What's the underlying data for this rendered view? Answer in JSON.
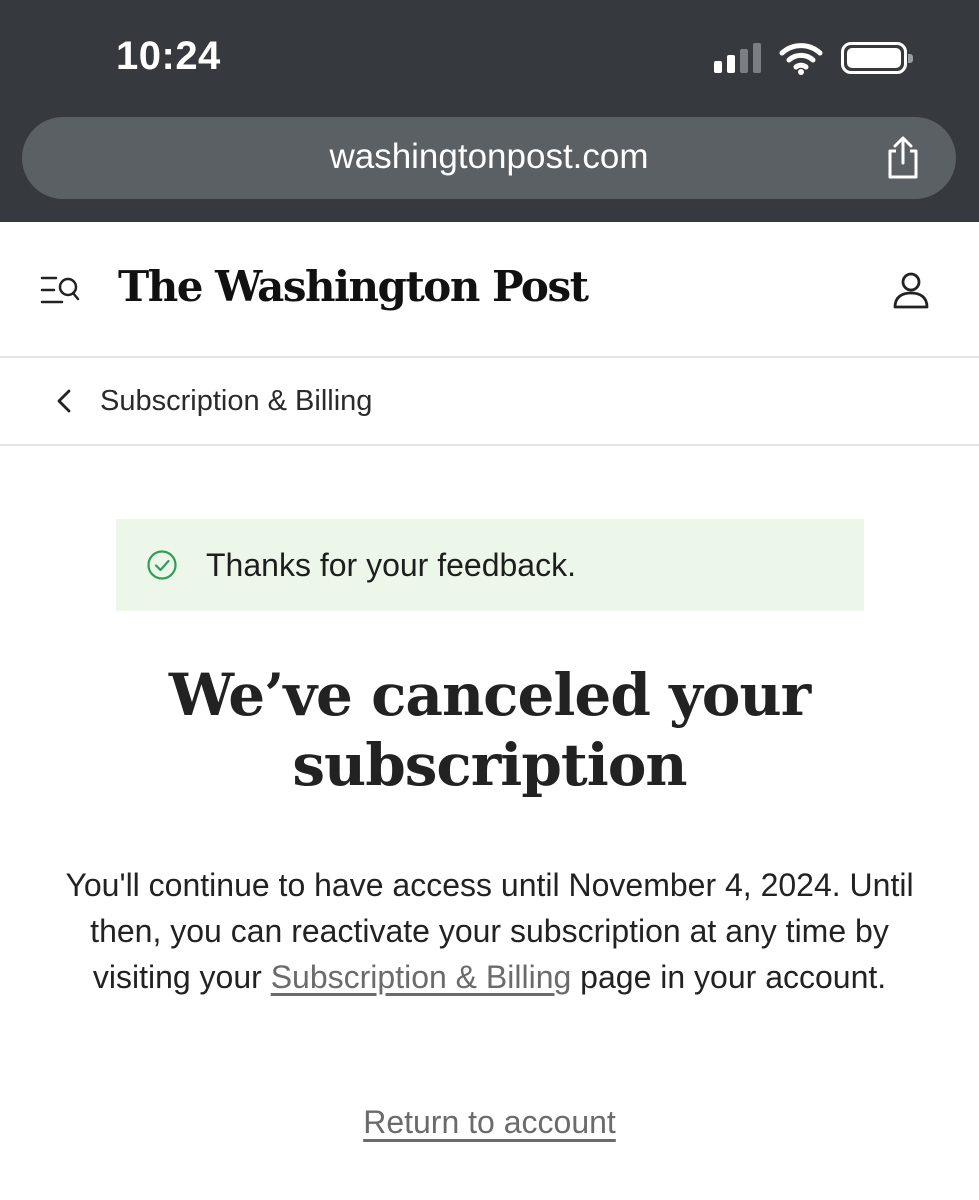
{
  "status_bar": {
    "time": "10:24"
  },
  "browser": {
    "url": "washingtonpost.com"
  },
  "header": {
    "logo": "The Washington Post"
  },
  "breadcrumb": {
    "label": "Subscription & Billing"
  },
  "alert": {
    "message": "Thanks for your feedback.",
    "color": "#ecf7ea",
    "icon_color": "#2f9e5a"
  },
  "main": {
    "title_line1": "We’ve canceled your",
    "title_line2": "subscription",
    "message_part1": "You'll continue to have access until November 4, 2024. Until then, you can reactivate your subscription at any time by visiting your ",
    "message_link": "Subscription & Billing",
    "message_part2": " page in your account.",
    "return_link": "Return to account"
  },
  "icons": {
    "menu": "menu-search-icon",
    "account": "account-icon",
    "back": "chevron-left-icon",
    "share": "share-icon",
    "success": "check-circle-icon"
  }
}
